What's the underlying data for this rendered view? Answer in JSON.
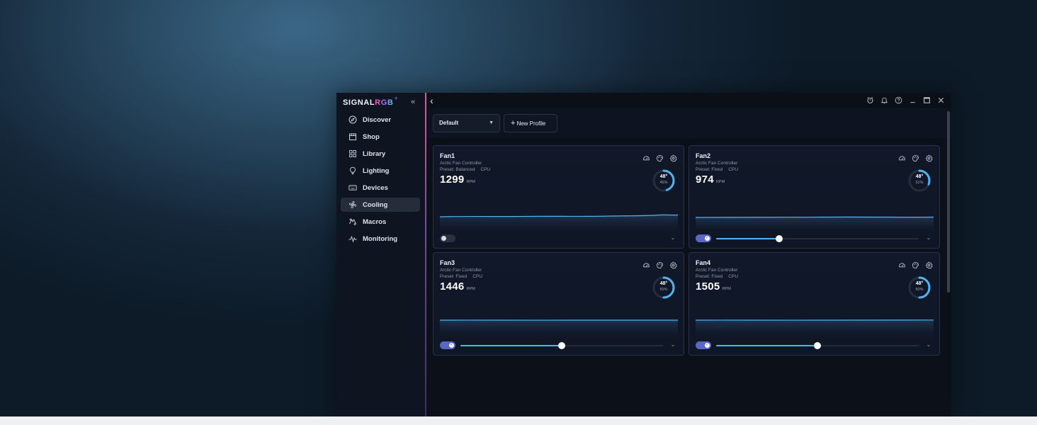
{
  "app": {
    "logo_text": "SIGNAL",
    "logo_accent": "RGB",
    "logo_plus": "+"
  },
  "sidebar": {
    "items": [
      {
        "label": "Discover",
        "icon": "compass-icon",
        "active": false
      },
      {
        "label": "Shop",
        "icon": "store-icon",
        "active": false
      },
      {
        "label": "Library",
        "icon": "grid-icon",
        "active": false
      },
      {
        "label": "Lighting",
        "icon": "bulb-icon",
        "active": false
      },
      {
        "label": "Devices",
        "icon": "keyboard-icon",
        "active": false
      },
      {
        "label": "Cooling",
        "icon": "fan-icon",
        "active": true
      },
      {
        "label": "Macros",
        "icon": "macro-icon",
        "active": false
      },
      {
        "label": "Monitoring",
        "icon": "pulse-icon",
        "active": false
      }
    ]
  },
  "toolbar": {
    "profile_selected": "Default",
    "new_profile_label": "New Profile"
  },
  "colors": {
    "accent": "#4fb4f0",
    "toggle_on": "#5a67c9",
    "brand_gradient": [
      "#ff5fa2",
      "#b06bff",
      "#4fd1ff"
    ]
  },
  "fans": [
    {
      "name": "Fan1",
      "controller": "Arctic Fan Controller",
      "preset": "Preset: Balanced",
      "source": "CPU",
      "rpm": "1299",
      "rpm_unit": "RPM",
      "temp": "48°",
      "percent": "45%",
      "gauge_fraction": 0.45,
      "enabled": false,
      "slider_fraction": null
    },
    {
      "name": "Fan2",
      "controller": "Arctic Fan Controller",
      "preset": "Preset: Fixed",
      "source": "CPU",
      "rpm": "974",
      "rpm_unit": "RPM",
      "temp": "48°",
      "percent": "31%",
      "gauge_fraction": 0.31,
      "enabled": true,
      "slider_fraction": 0.31
    },
    {
      "name": "Fan3",
      "controller": "Arctic Fan Controller",
      "preset": "Preset: Fixed",
      "source": "CPU",
      "rpm": "1446",
      "rpm_unit": "RPM",
      "temp": "48°",
      "percent": "50%",
      "gauge_fraction": 0.5,
      "enabled": true,
      "slider_fraction": 0.5
    },
    {
      "name": "Fan4",
      "controller": "Arctic Fan Controller",
      "preset": "Preset: Fixed",
      "source": "CPU",
      "rpm": "1505",
      "rpm_unit": "RPM",
      "temp": "48°",
      "percent": "50%",
      "gauge_fraction": 0.5,
      "enabled": true,
      "slider_fraction": 0.5
    }
  ]
}
